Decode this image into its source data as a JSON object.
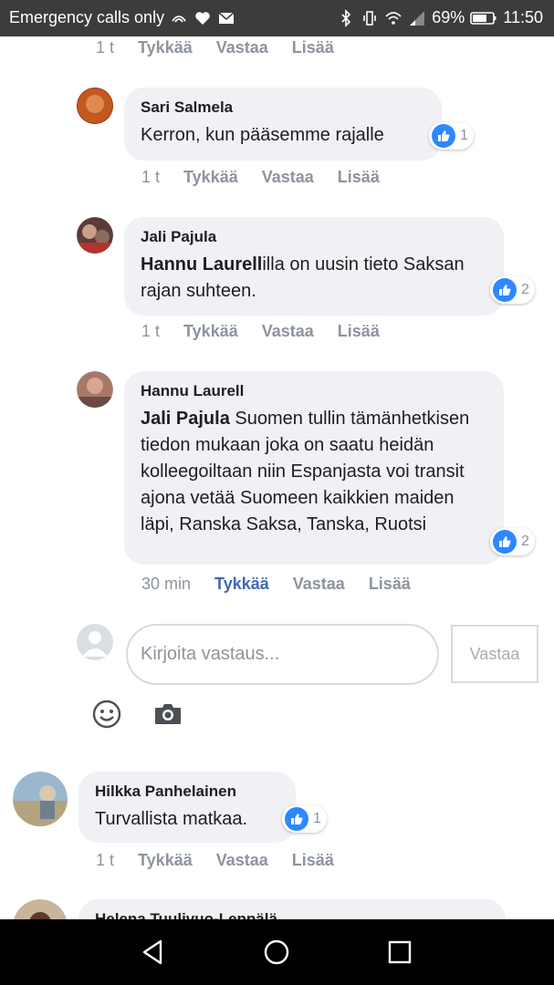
{
  "status_bar": {
    "carrier": "Emergency calls only",
    "battery": "69%",
    "time": "11:50"
  },
  "top_actions": {
    "time": "1 t",
    "like": "Tykkää",
    "reply": "Vastaa",
    "more": "Lisää"
  },
  "comments": [
    {
      "author": "Sari Salmela",
      "text": "Kerron, kun pääsemme rajalle",
      "mention": "",
      "reaction_count": "1",
      "time": "1 t",
      "like": "Tykkää",
      "reply": "Vastaa",
      "more": "Lisää"
    },
    {
      "author": "Jali Pajula",
      "mention": "Hannu Laurell",
      "text": "illa on uusin tieto Saksan rajan suhteen.",
      "reaction_count": "2",
      "time": "1 t",
      "like": "Tykkää",
      "reply": "Vastaa",
      "more": "Lisää"
    },
    {
      "author": "Hannu Laurell",
      "mention": "Jali Pajula",
      "text": " Suomen tullin tämänhetkisen tiedon mukaan joka on saatu heidän kolleegoiltaan niin Espanjasta voi transit ajona vetää Suomeen kaikkien maiden läpi, Ranska Saksa, Tanska, Ruotsi",
      "reaction_count": "2",
      "time": "30 min",
      "like": "Tykkää",
      "reply": "Vastaa",
      "more": "Lisää"
    },
    {
      "author": "Hilkka Panhelainen",
      "text": "Turvallista matkaa.",
      "mention": "",
      "reaction_count": "1",
      "time": "1 t",
      "like": "Tykkää",
      "reply": "Vastaa",
      "more": "Lisää"
    },
    {
      "author": "Helena Tuulivuo-Leppälä"
    }
  ],
  "reply_box": {
    "placeholder": "Kirjoita vastaus...",
    "button_label": "Vastaa"
  },
  "icons": {
    "emoji": "smiley-icon",
    "camera": "camera-icon",
    "like": "thumbs-up-icon"
  },
  "colors": {
    "accent": "#4267b2",
    "like_badge": "#2d88ff",
    "bubble": "#f0f1f4",
    "muted": "#8d949e"
  }
}
